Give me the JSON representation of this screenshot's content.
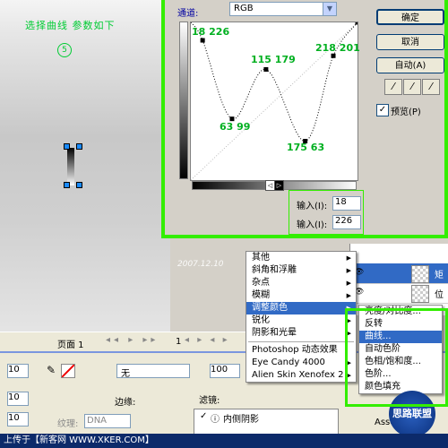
{
  "canvas": {
    "instruction": "选择曲线 参数如下",
    "step": "5",
    "watermark": "2007.12.10"
  },
  "dialog": {
    "channel_label": "通道:",
    "channel_value": "RGB",
    "buttons": {
      "ok": "确定",
      "cancel": "取消",
      "auto": "自动(A)",
      "preview": "预览(P)"
    },
    "preview_checked": true,
    "curve_labels": {
      "p1": "18 226",
      "p2": "115 179",
      "p3": "218 201",
      "p4": "63 99",
      "p5": "175 63"
    },
    "input_label": "输入(I):",
    "output_label": "输入(I):",
    "input_value": "18",
    "output_value": "226",
    "chart_data": {
      "type": "line",
      "x": [
        18,
        63,
        115,
        175,
        218,
        255
      ],
      "y": [
        226,
        99,
        179,
        63,
        201,
        255
      ],
      "xlim": [
        0,
        255
      ],
      "ylim": [
        0,
        255
      ]
    }
  },
  "menu": {
    "items": [
      {
        "label": "其他",
        "sub": true
      },
      {
        "label": "斜角和浮雕",
        "sub": true
      },
      {
        "label": "杂点",
        "sub": true
      },
      {
        "label": "模糊",
        "sub": true
      },
      {
        "label": "调整颜色",
        "sub": true,
        "selected": true
      },
      {
        "label": "锐化",
        "sub": true
      },
      {
        "label": "阴影和光晕",
        "sub": true
      },
      {
        "label": "Photoshop 动态效果",
        "sub": false
      },
      {
        "label": "Eye Candy 4000",
        "sub": true
      },
      {
        "label": "Alien Skin Xenofex 2",
        "sub": true
      }
    ]
  },
  "submenu": {
    "items": [
      {
        "label": "亮度/对比度..."
      },
      {
        "label": "反转"
      },
      {
        "label": "曲线...",
        "selected": true
      },
      {
        "label": "自动色阶"
      },
      {
        "label": "色相/饱和度..."
      },
      {
        "label": "色阶..."
      },
      {
        "label": "颜色填充"
      }
    ]
  },
  "layers": {
    "row1": "矩",
    "row2": "位",
    "assets": "Assets"
  },
  "toolbar": {
    "page_label": "页面 1",
    "page_num": "1"
  },
  "props": {
    "field1": "10",
    "field2": "10",
    "field3": "10",
    "stroke_value": "无",
    "opacity": "100",
    "edge_label": "边缘:",
    "texture_label": "纹理:",
    "texture_value": "DNA",
    "filters_label": "滤镜:",
    "filter_item": "内侧阴影"
  },
  "status": {
    "text": "上传于【新客网 WWW.XKER.COM】"
  },
  "brand": "思路联盟",
  "colors": {
    "highlight": "#33ee00",
    "label_green": "#00b020",
    "menu_select": "#316ac5"
  }
}
